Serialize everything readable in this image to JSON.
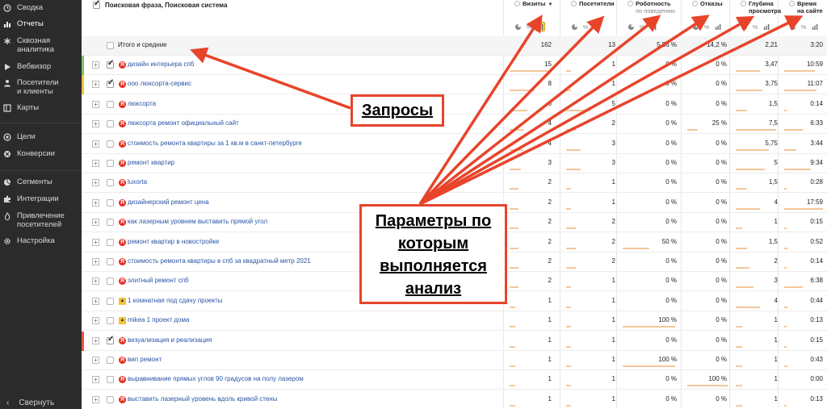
{
  "sidebar": {
    "items": [
      {
        "label": "Сводка",
        "icon": "clock-icon",
        "active": false
      },
      {
        "label": "Отчеты",
        "icon": "bar-chart-icon",
        "active": true
      },
      {
        "label": "Сквозная\nаналитика",
        "icon": "asterisk-icon",
        "active": false
      },
      {
        "label": "Вебвизор",
        "icon": "play-icon",
        "active": false
      },
      {
        "label": "Посетители\nи клиенты",
        "icon": "person-icon",
        "active": false
      },
      {
        "label": "Карты",
        "icon": "map-icon",
        "active": false
      },
      {
        "label": "Цели",
        "icon": "target-icon",
        "active": false
      },
      {
        "label": "Конверсии",
        "icon": "conversion-icon",
        "active": false
      },
      {
        "label": "Сегменты",
        "icon": "segments-icon",
        "active": false
      },
      {
        "label": "Интеграции",
        "icon": "puzzle-icon",
        "active": false
      },
      {
        "label": "Привлечение\nпосетителей",
        "icon": "flame-icon",
        "active": false
      },
      {
        "label": "Настройка",
        "icon": "gear-icon",
        "active": false
      }
    ],
    "collapse_label": "Свернуть",
    "collapse_icon": "chevron-left-icon"
  },
  "table": {
    "dimension_header": "Поисковая фраза, Поисковая система",
    "columns": [
      {
        "label": "Визиты",
        "sub": "",
        "sort": "▼"
      },
      {
        "label": "Посетители",
        "sub": ""
      },
      {
        "label": "Роботность",
        "sub": "по поведению"
      },
      {
        "label": "Отказы",
        "sub": ""
      },
      {
        "label": "Глубина\nпросмотра",
        "sub": ""
      },
      {
        "label": "Время\nна сайте",
        "sub": ""
      }
    ],
    "total": {
      "label": "Итого и средние",
      "values": [
        "162",
        "13",
        "5,56 %",
        "14,2 %",
        "2,21",
        "3:20"
      ]
    },
    "rows": [
      {
        "phrase": "дизайн интерьера спб",
        "icon": "yandex",
        "checked": true,
        "marker": "#7cc46a",
        "values": [
          "15",
          "1",
          "0 %",
          "0 %",
          "3,47",
          "10:59"
        ],
        "bars": [
          0.9,
          0.1,
          0,
          0,
          0.55,
          0.75
        ]
      },
      {
        "phrase": "ооо люксорта-сервис",
        "icon": "yandex",
        "checked": true,
        "marker": "#f0c23b",
        "values": [
          "8",
          "1",
          "0 %",
          "0 %",
          "3,75",
          "11:07"
        ],
        "bars": [
          0.55,
          0.1,
          0,
          0,
          0.6,
          0.8
        ]
      },
      {
        "phrase": "люксорта",
        "icon": "yandex",
        "checked": false,
        "marker": "",
        "values": [
          "6",
          "5",
          "0 %",
          "0 %",
          "1,5",
          "0:14"
        ],
        "bars": [
          0.4,
          0.5,
          0,
          0,
          0.25,
          0.05
        ]
      },
      {
        "phrase": "люксорта ремонт официальный сайт",
        "icon": "yandex",
        "checked": false,
        "marker": "",
        "values": [
          "4",
          "2",
          "0 %",
          "25 %",
          "7,5",
          "6:33"
        ],
        "bars": [
          0.3,
          0.2,
          0,
          0.25,
          0.9,
          0.45
        ]
      },
      {
        "phrase": "стоимость ремонта квартиры за 1 кв.м в санкт-петербурге",
        "icon": "yandex",
        "checked": false,
        "marker": "",
        "values": [
          "4",
          "3",
          "0 %",
          "0 %",
          "5,75",
          "3:44"
        ],
        "bars": [
          0.3,
          0.3,
          0,
          0,
          0.75,
          0.3
        ]
      },
      {
        "phrase": "ремонт квартир",
        "icon": "yandex",
        "checked": false,
        "marker": "",
        "values": [
          "3",
          "3",
          "0 %",
          "0 %",
          "5",
          "9:34"
        ],
        "bars": [
          0.25,
          0.3,
          0,
          0,
          0.65,
          0.65
        ]
      },
      {
        "phrase": "luxorta",
        "icon": "yandex",
        "checked": false,
        "marker": "",
        "values": [
          "2",
          "1",
          "0 %",
          "0 %",
          "1,5",
          "0:28"
        ],
        "bars": [
          0.2,
          0.1,
          0,
          0,
          0.25,
          0.05
        ]
      },
      {
        "phrase": "дизайнерский ремонт цена",
        "icon": "yandex",
        "checked": false,
        "marker": "",
        "values": [
          "2",
          "1",
          "0 %",
          "0 %",
          "4",
          "17:59"
        ],
        "bars": [
          0.2,
          0.1,
          0,
          0,
          0.55,
          0.95
        ]
      },
      {
        "phrase": "как лазерным уровнем выставить прямой угол",
        "icon": "yandex",
        "checked": false,
        "marker": "",
        "values": [
          "2",
          "2",
          "0 %",
          "0 %",
          "1",
          "0:15"
        ],
        "bars": [
          0.2,
          0.2,
          0,
          0,
          0.15,
          0.05
        ]
      },
      {
        "phrase": "ремонт квартир в новостройке",
        "icon": "yandex",
        "checked": false,
        "marker": "",
        "values": [
          "2",
          "2",
          "50 %",
          "0 %",
          "1,5",
          "0:52"
        ],
        "bars": [
          0.2,
          0.2,
          0.5,
          0,
          0.25,
          0.08
        ]
      },
      {
        "phrase": "стоимость ремонта квартиры в спб за квадратный метр 2021",
        "icon": "yandex",
        "checked": false,
        "marker": "",
        "values": [
          "2",
          "2",
          "0 %",
          "0 %",
          "2",
          "0:14"
        ],
        "bars": [
          0.2,
          0.2,
          0,
          0,
          0.3,
          0.05
        ]
      },
      {
        "phrase": "элитный ремонт спб",
        "icon": "yandex",
        "checked": false,
        "marker": "",
        "values": [
          "2",
          "1",
          "0 %",
          "0 %",
          "3",
          "6:38"
        ],
        "bars": [
          0.2,
          0.1,
          0,
          0,
          0.4,
          0.45
        ]
      },
      {
        "phrase": "1 комнатная под сдачу проекты",
        "icon": "image",
        "checked": false,
        "marker": "",
        "values": [
          "1",
          "1",
          "0 %",
          "0 %",
          "4",
          "0:44"
        ],
        "bars": [
          0.12,
          0.1,
          0,
          0,
          0.55,
          0.08
        ]
      },
      {
        "phrase": "mikea 1 проект дома",
        "icon": "image",
        "checked": false,
        "marker": "",
        "values": [
          "1",
          "1",
          "100 %",
          "0 %",
          "1",
          "0:13"
        ],
        "bars": [
          0.12,
          0.1,
          1,
          0,
          0.15,
          0.05
        ]
      },
      {
        "phrase": "визуализация и реализация",
        "icon": "yandex",
        "checked": true,
        "marker": "#e8543a",
        "values": [
          "1",
          "1",
          "0 %",
          "0 %",
          "1",
          "0:15"
        ],
        "bars": [
          0.12,
          0.1,
          0,
          0,
          0.15,
          0.05
        ]
      },
      {
        "phrase": "вип ремонт",
        "icon": "yandex",
        "checked": false,
        "marker": "",
        "values": [
          "1",
          "1",
          "100 %",
          "0 %",
          "1",
          "0:43"
        ],
        "bars": [
          0.12,
          0.1,
          1,
          0,
          0.15,
          0.08
        ]
      },
      {
        "phrase": "выравнивание прямых углов 90 градусов на полу лазером",
        "icon": "yandex",
        "checked": false,
        "marker": "",
        "values": [
          "1",
          "1",
          "0 %",
          "100 %",
          "1",
          "0:00"
        ],
        "bars": [
          0.12,
          0.1,
          0,
          1,
          0.15,
          0
        ]
      },
      {
        "phrase": "выставить лазерный уровень вдоль кривой стены",
        "icon": "yandex",
        "checked": false,
        "marker": "",
        "values": [
          "1",
          "1",
          "0 %",
          "0 %",
          "1",
          "0:13"
        ],
        "bars": [
          0.12,
          0.1,
          0,
          0,
          0.15,
          0.05
        ]
      }
    ]
  },
  "annotations": {
    "queries_label": "Запросы",
    "params_label": "Параметры по\nкоторым\nвыполняется\nанализ",
    "color": "#e8442b"
  }
}
